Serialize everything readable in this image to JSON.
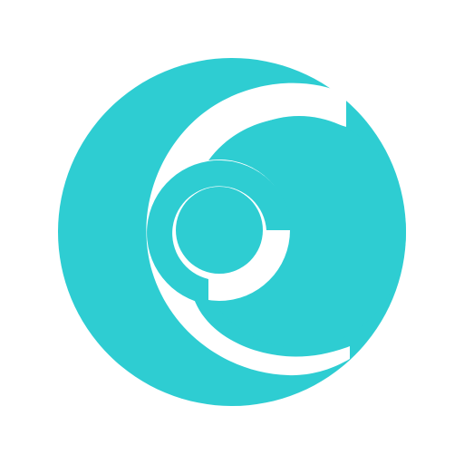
{
  "logo": {
    "icon": "spiral-ring-logo-icon",
    "colors": {
      "primary": "#2ecdd2",
      "background": "#ffffff"
    }
  }
}
